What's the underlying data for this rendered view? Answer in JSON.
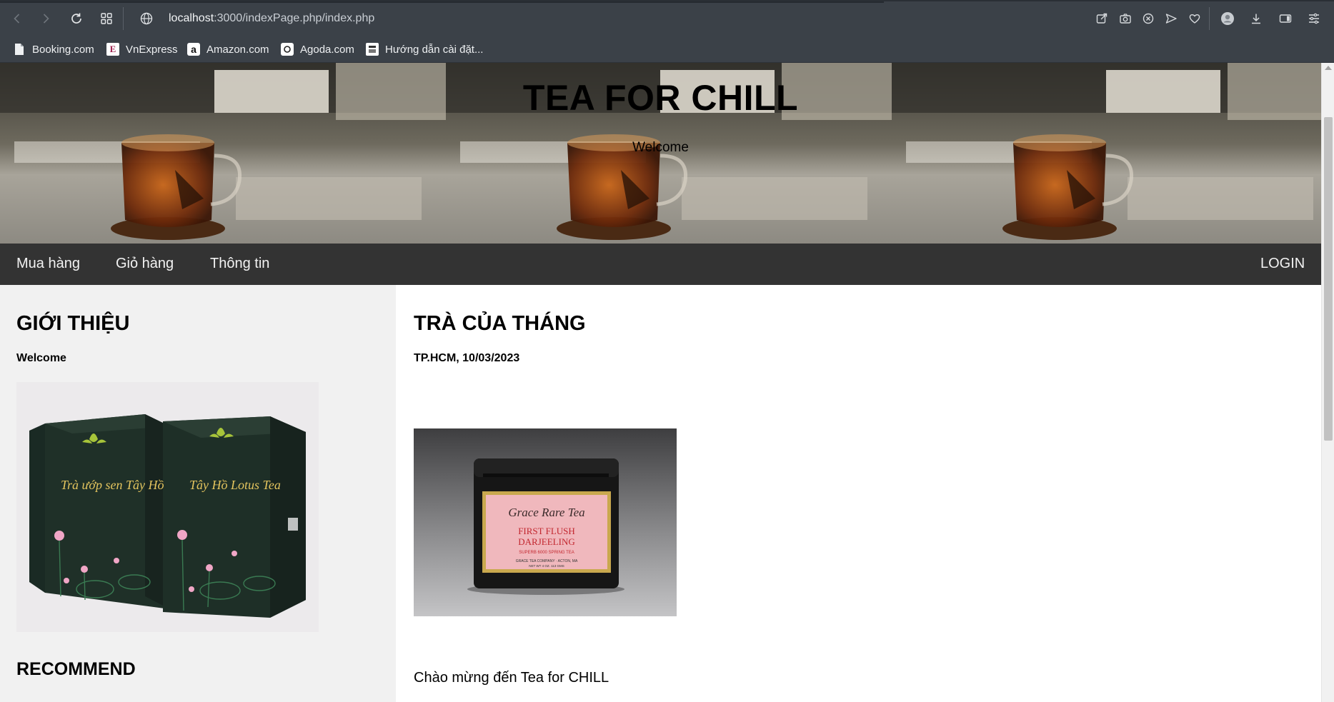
{
  "browser": {
    "url_host": "localhost",
    "url_rest": ":3000/indexPage.php/index.php",
    "bookmarks": [
      {
        "label": "Booking.com",
        "icon": "page-icon"
      },
      {
        "label": "VnExpress",
        "icon": "vnexpress-icon"
      },
      {
        "label": "Amazon.com",
        "icon": "amazon-icon"
      },
      {
        "label": "Agoda.com",
        "icon": "agoda-icon"
      },
      {
        "label": "Hướng dẫn cài đặt...",
        "icon": "guide-icon"
      }
    ]
  },
  "header": {
    "title": "TEA FOR CHILL",
    "subtitle": "Welcome"
  },
  "nav": {
    "items": [
      "Mua hàng",
      "Giỏ hàng",
      "Thông tin"
    ],
    "login": "LOGIN"
  },
  "left": {
    "heading": "GIỚI THIỆU",
    "subheading": "Welcome",
    "box_text_1": "Trà ướp sen Tây Hồ",
    "box_text_2": "Tây Hồ Lotus Tea",
    "recommend": "RECOMMEND"
  },
  "main": {
    "heading": "TRÀ CỦA THÁNG",
    "dateline": "TP.HCM, 10/03/2023",
    "tin_brand": "Grace Rare Tea",
    "tin_line1": "FIRST FLUSH",
    "tin_line2": "DARJEELING",
    "tin_small1": "SUPERB 6000 SPRING TEA",
    "tin_small2": "GRACE TEA COMPANY · ACTON, MA",
    "tin_small3": "NET WT 4 OZ. 113 GMS",
    "paragraph": "Chào mừng đến Tea for CHILL"
  },
  "colors": {
    "chrome": "#3b4148",
    "navbar": "#333333",
    "sidebar": "#f1f1f1"
  }
}
